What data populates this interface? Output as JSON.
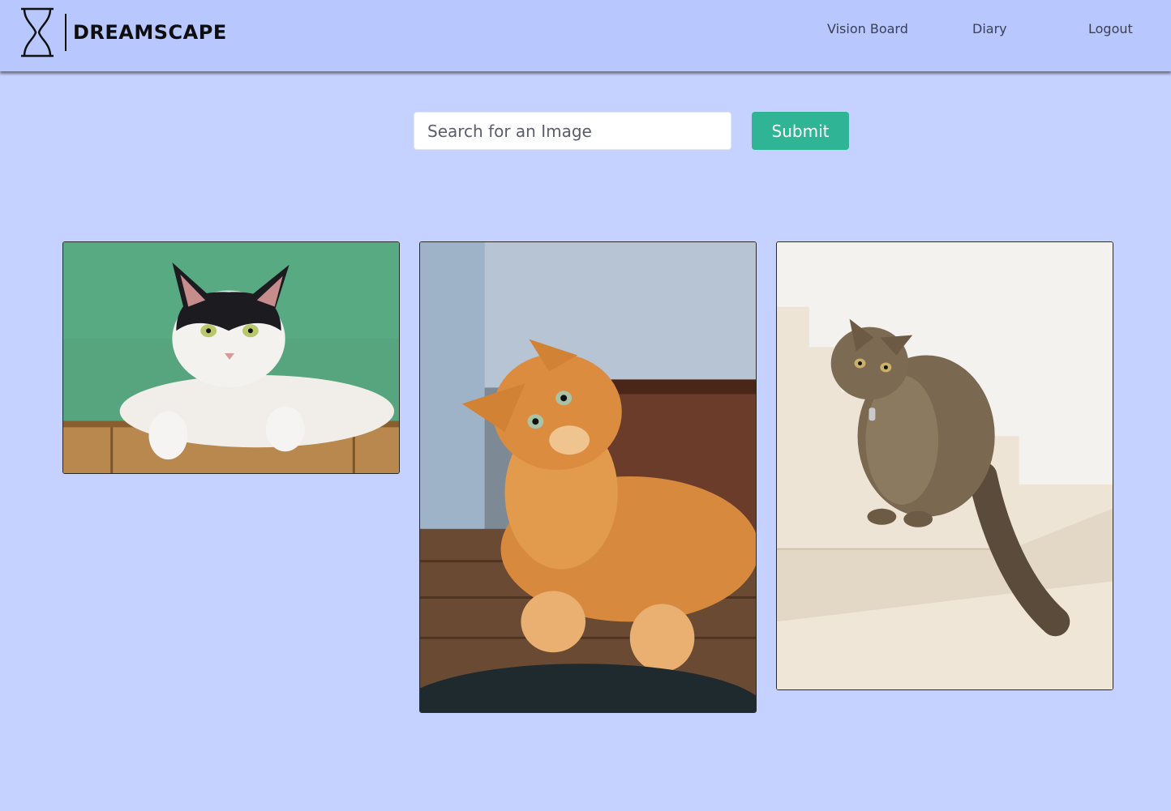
{
  "app": {
    "brand": "DREAMSCAPE",
    "logo_icon": "hourglass-icon"
  },
  "nav": {
    "items": [
      {
        "label": "Vision Board"
      },
      {
        "label": "Diary"
      },
      {
        "label": "Logout"
      }
    ]
  },
  "search": {
    "placeholder": "Search for an Image",
    "value": "",
    "submit_label": "Submit"
  },
  "colors": {
    "page_background": "#c5d1fe",
    "navbar_background": "#b8c7fe",
    "submit_button": "#2fb596"
  },
  "gallery": {
    "images": [
      {
        "subject": "black-and-white cat on green background"
      },
      {
        "subject": "orange tabby cat looking up on wooden table"
      },
      {
        "subject": "brown tabby cat sitting on white stairs"
      }
    ]
  }
}
